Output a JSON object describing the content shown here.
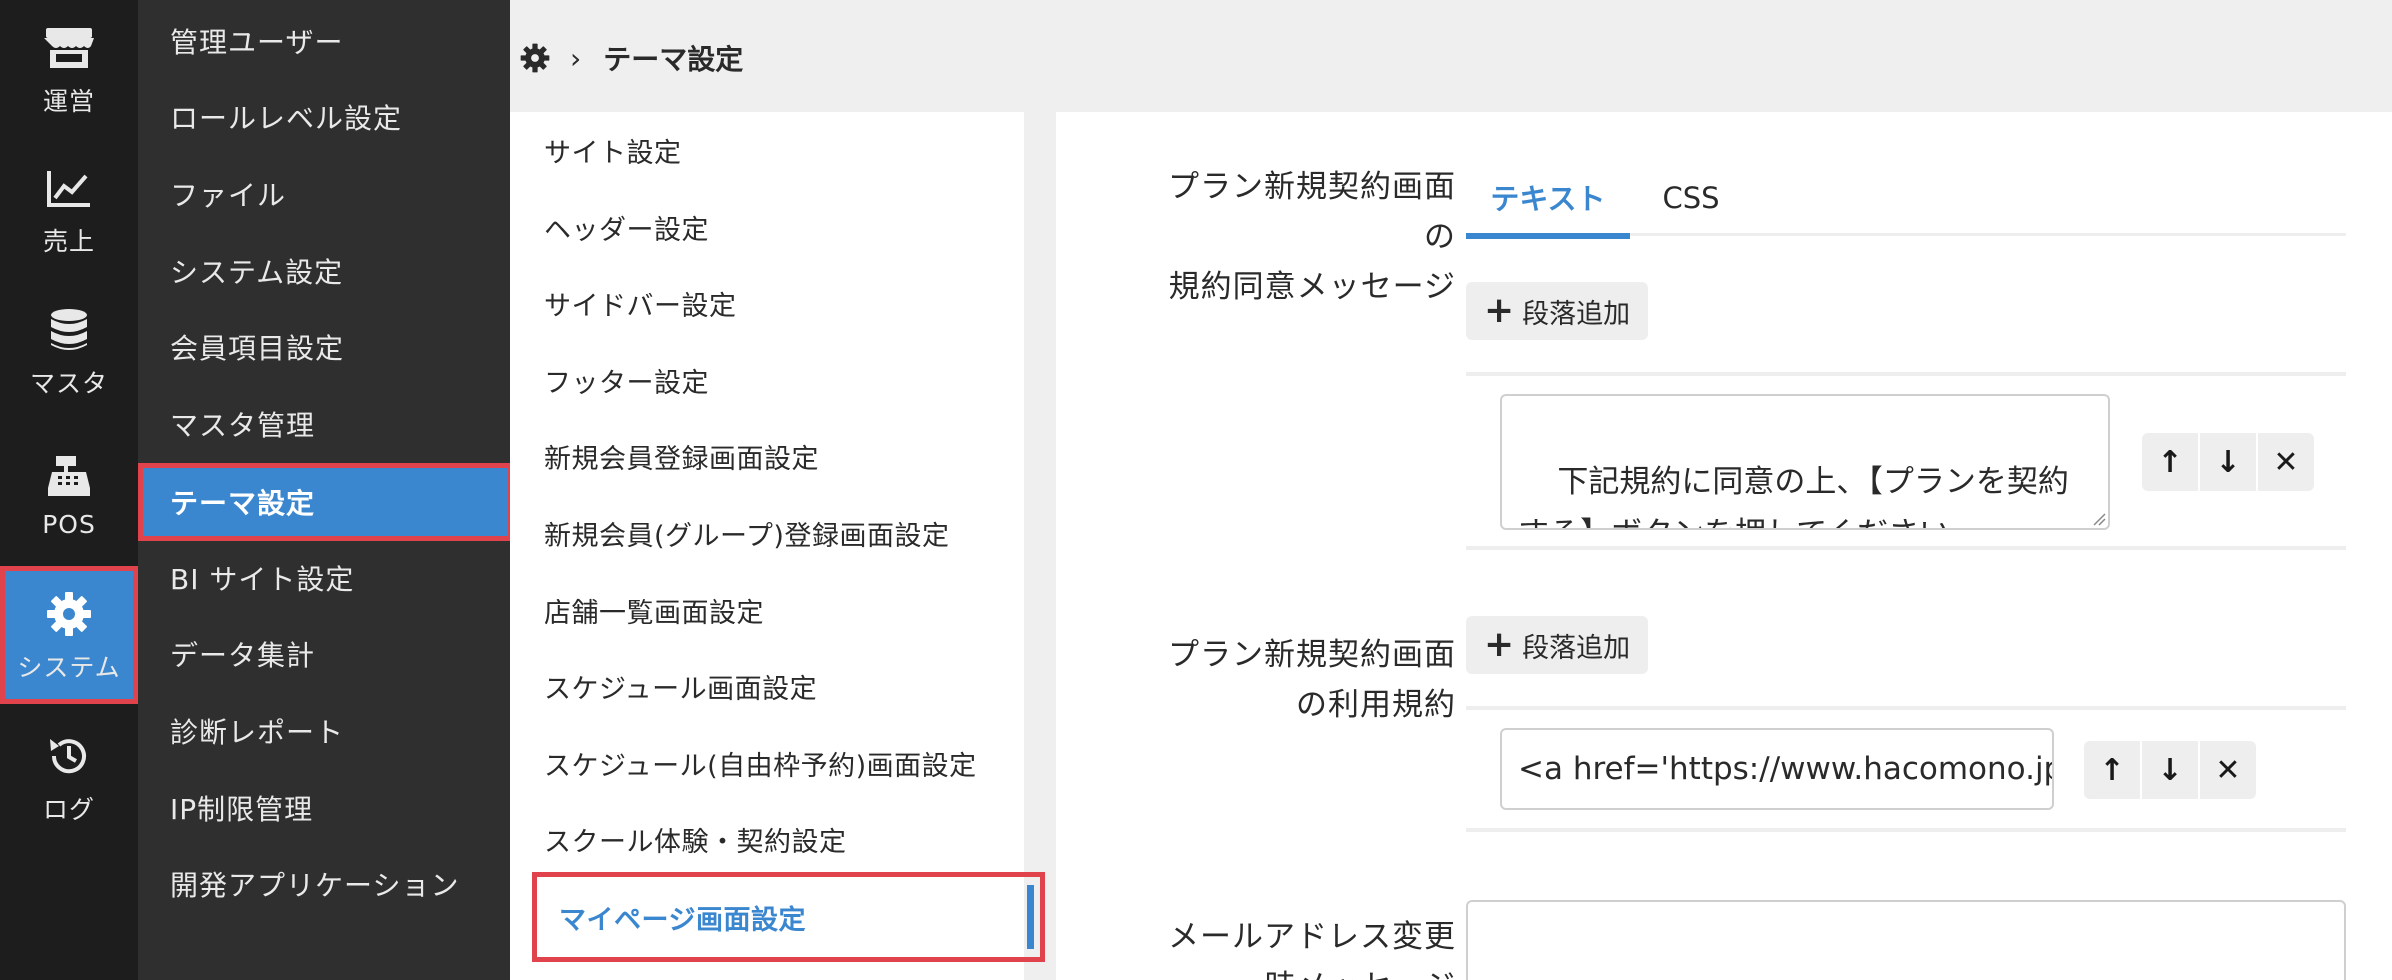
{
  "rail": {
    "items": [
      {
        "label": "運営",
        "icon": "store-icon"
      },
      {
        "label": "売上",
        "icon": "chart-line-icon"
      },
      {
        "label": "マスタ",
        "icon": "database-icon"
      },
      {
        "label": "POS",
        "icon": "cash-register-icon"
      },
      {
        "label": "システム",
        "icon": "gear-icon"
      },
      {
        "label": "ログ",
        "icon": "history-icon"
      }
    ],
    "active": "システム"
  },
  "submenu": {
    "items": [
      "管理ユーザー",
      "ロールレベル設定",
      "ファイル",
      "システム設定",
      "会員項目設定",
      "マスタ管理",
      "テーマ設定",
      "BI サイト設定",
      "データ集計",
      "診断レポート",
      "IP制限管理",
      "開発アプリケーション"
    ],
    "active": "テーマ設定"
  },
  "breadcrumb": {
    "separator": "›",
    "current": "テーマ設定"
  },
  "theme_list": {
    "items": [
      "サイト設定",
      "ヘッダー設定",
      "サイドバー設定",
      "フッター設定",
      "新規会員登録画面設定",
      "新規会員(グループ)登録画面設定",
      "店舗一覧画面設定",
      "スケジュール画面設定",
      "スケジュール(自由枠予約)画面設定",
      "スクール体験・契約設定",
      "マイページ画面設定"
    ],
    "active": "マイページ画面設定"
  },
  "main": {
    "tabs": [
      "テキスト",
      "CSS"
    ],
    "active_tab": "テキスト",
    "fields": [
      {
        "label_lines": [
          "プラン新規契約画面",
          "の",
          "規約同意メッセージ"
        ],
        "add_label": "段落追加",
        "paragraph": "下記規約に同意の上、【プランを契約する】ボタンを押してください。"
      },
      {
        "label_lines": [
          "プラン新規契約画面",
          "の利用規約"
        ],
        "add_label": "段落追加",
        "paragraph": "<a href='https://www.hacomono.jp' t"
      },
      {
        "label_lines": [
          "メールアドレス変更",
          "時メッセージ"
        ]
      }
    ],
    "controls": {
      "up": "↑",
      "down": "↓",
      "delete": "✕"
    }
  },
  "colors": {
    "accent": "#3b87cf",
    "highlight_border": "#e0434b",
    "rail_bg": "#1d1d1d",
    "submenu_bg": "#2f2f2f"
  }
}
